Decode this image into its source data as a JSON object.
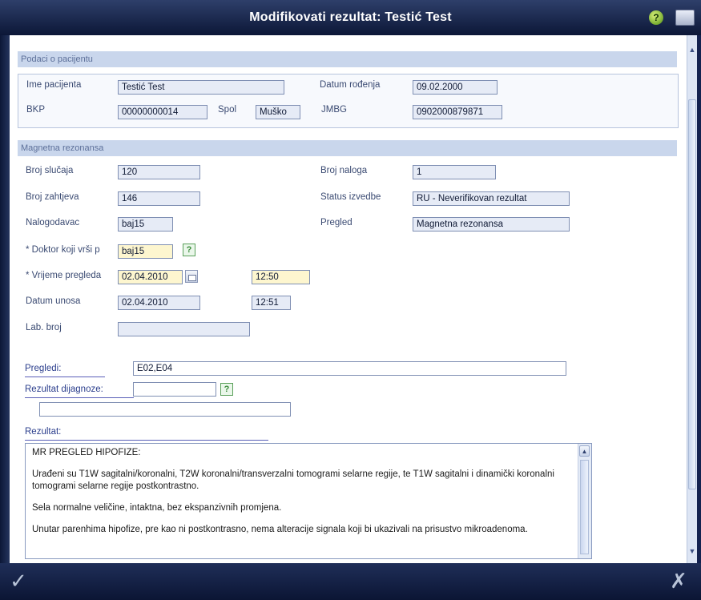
{
  "window": {
    "title": "Modifikovati rezultat: Testić Test",
    "help_icon": "help-icon",
    "restore_icon": "window-icon"
  },
  "patient": {
    "header": "Podaci o pacijentu",
    "name_label": "Ime pacijenta",
    "name_value": "Testić Test",
    "dob_label": "Datum rođenja",
    "dob_value": "09.02.2000",
    "bkp_label": "BKP",
    "bkp_value": "00000000014",
    "sex_label": "Spol",
    "sex_value": "Muško",
    "jmbg_label": "JMBG",
    "jmbg_value": "0902000879871"
  },
  "mr": {
    "header": "Magnetna rezonansa",
    "case_label": "Broj slučaja",
    "case_value": "120",
    "order_label": "Broj naloga",
    "order_value": "1",
    "request_label": "Broj zahtjeva",
    "request_value": "146",
    "status_label": "Status izvedbe",
    "status_value": "RU - Neverifikovan rezultat",
    "orderer_label": "Nalogodavac",
    "orderer_value": "baj15",
    "exam_label": "Pregled",
    "exam_value": "Magnetna rezonansa",
    "doctor_label": "* Doktor koji vrši p",
    "doctor_value": "baj15",
    "exam_time_label": "* Vrijeme pregleda",
    "exam_date_value": "02.04.2010",
    "exam_time_value": "12:50",
    "entry_label": "Datum unosa",
    "entry_date_value": "02.04.2010",
    "entry_time_value": "12:51",
    "lab_label": "Lab. broj",
    "lab_value": "",
    "lookup_symbol": "?"
  },
  "details": {
    "exams_label": "Pregledi:",
    "exams_value": "E02,E04",
    "diagnosis_label": "Rezultat dijagnoze:",
    "diagnosis_value": "",
    "diagnosis_text_value": "",
    "result_label": "Rezultat:",
    "result_paragraphs": [
      "MR PREGLED HIPOFIZE:",
      "Urađeni su T1W sagitalni/koronalni, T2W koronalni/transverzalni tomogrami selarne regije, te T1W sagitalni i dinamički koronalni tomogrami selarne regije postkontrastno.",
      "Sela normalne veličine, intaktna, bez ekspanzivnih promjena.",
      "Unutar parenhima hipofize, pre kao ni postkontrasno, nema alteracije signala koji bi ukazivali na prisustvo mikroadenoma."
    ]
  },
  "footer": {
    "ok_symbol": "✓",
    "cancel_symbol": "✗"
  }
}
